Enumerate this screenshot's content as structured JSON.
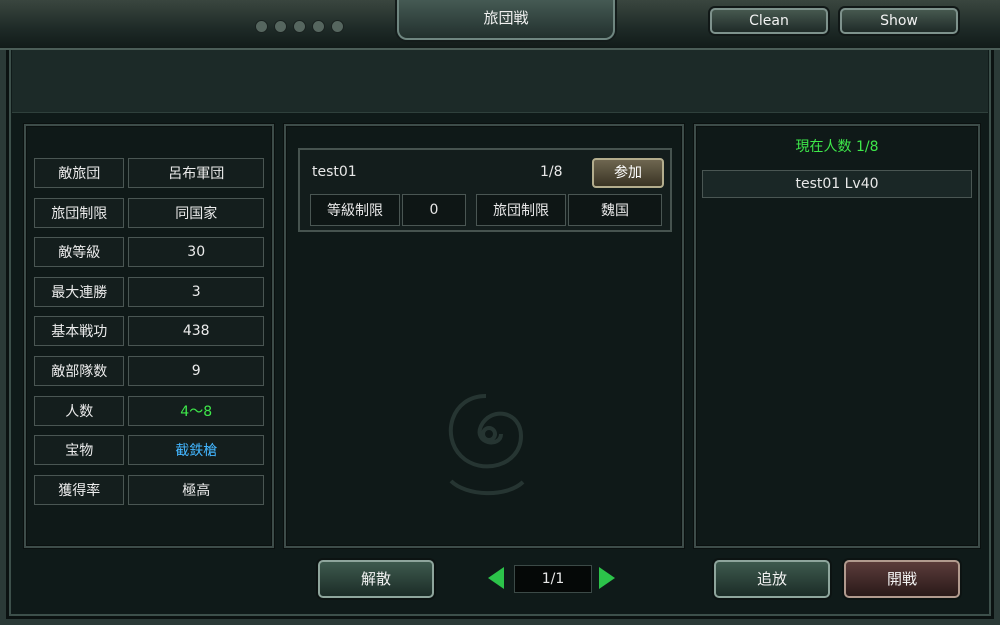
{
  "window": {
    "title": "旅団戦",
    "clean_button": "Clean",
    "show_button": "Show"
  },
  "left_panel": {
    "rows": [
      {
        "label": "敵旅団",
        "value": "呂布軍団"
      },
      {
        "label": "旅団制限",
        "value": "同国家"
      },
      {
        "label": "敵等級",
        "value": "30"
      },
      {
        "label": "最大連勝",
        "value": "3"
      },
      {
        "label": "基本戦功",
        "value": "438"
      },
      {
        "label": "敵部隊数",
        "value": "9"
      },
      {
        "label": "人数",
        "value": "4～8",
        "value_color": "#3ee84a"
      },
      {
        "label": "宝物",
        "value": "截鉄槍",
        "value_color": "#43b6ff"
      },
      {
        "label": "獲得率",
        "value": "極高"
      }
    ]
  },
  "room_list": {
    "rooms": [
      {
        "name": "test01",
        "count": "1/8",
        "join_label": "参加",
        "level_limit_label": "等級制限",
        "level_limit_value": "0",
        "brigade_limit_label": "旅団制限",
        "brigade_limit_value": "魏国"
      }
    ]
  },
  "members_panel": {
    "title": "現在人数 1/8",
    "title_color": "#3ee84a",
    "members": [
      "test01 Lv40"
    ]
  },
  "footer": {
    "disband_label": "解散",
    "page_indicator": "1/1",
    "kick_label": "追放",
    "start_label": "開戦"
  },
  "icons": {
    "prev_page": "triangle-left-icon",
    "next_page": "triangle-right-icon"
  }
}
